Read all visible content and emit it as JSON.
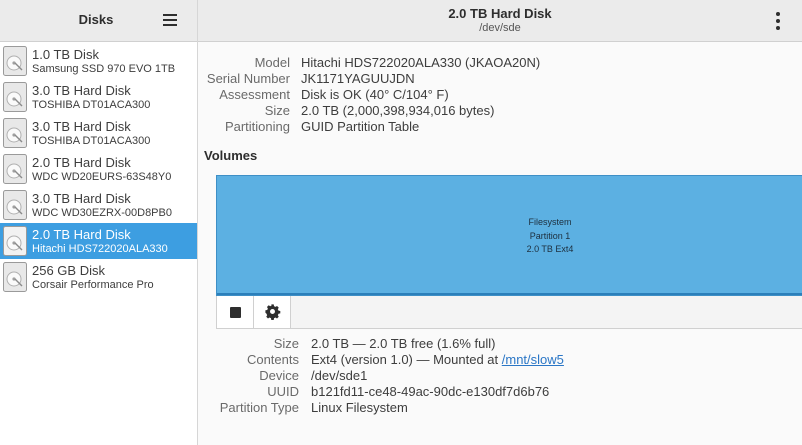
{
  "sidebar": {
    "title": "Disks",
    "disks": [
      {
        "name": "1.0 TB Disk",
        "model": "Samsung SSD 970 EVO 1TB"
      },
      {
        "name": "3.0 TB Hard Disk",
        "model": "TOSHIBA DT01ACA300"
      },
      {
        "name": "3.0 TB Hard Disk",
        "model": "TOSHIBA DT01ACA300"
      },
      {
        "name": "2.0 TB Hard Disk",
        "model": "WDC WD20EURS-63S48Y0"
      },
      {
        "name": "3.0 TB Hard Disk",
        "model": "WDC WD30EZRX-00D8PB0"
      },
      {
        "name": "2.0 TB Hard Disk",
        "model": "Hitachi HDS722020ALA330"
      },
      {
        "name": "256 GB Disk",
        "model": "Corsair Performance Pro"
      }
    ],
    "selected_index": 5
  },
  "header": {
    "title": "2.0 TB Hard Disk",
    "subtitle": "/dev/sde"
  },
  "disk_info": {
    "model_label": "Model",
    "model": "Hitachi HDS722020ALA330 (JKAOA20N)",
    "serial_label": "Serial Number",
    "serial": "JK1171YAGUUJDN",
    "assessment_label": "Assessment",
    "assessment": "Disk is OK (40° C/104° F)",
    "size_label": "Size",
    "size": "2.0 TB (2,000,398,934,016 bytes)",
    "partitioning_label": "Partitioning",
    "partitioning": "GUID Partition Table"
  },
  "volumes": {
    "label": "Volumes",
    "partition": {
      "line1": "Filesystem",
      "line2": "Partition 1",
      "line3": "2.0 TB Ext4"
    }
  },
  "partition_info": {
    "size_label": "Size",
    "size": "2.0 TB — 2.0 TB free (1.6% full)",
    "contents_label": "Contents",
    "contents_prefix": "Ext4 (version 1.0) — Mounted at ",
    "mount_point": "/mnt/slow5",
    "device_label": "Device",
    "device": "/dev/sde1",
    "uuid_label": "UUID",
    "uuid": "b121fd11-ce48-49ac-90dc-e130df7d6b76",
    "type_label": "Partition Type",
    "type": "Linux Filesystem"
  },
  "colors": {
    "selection": "#3d9ee1",
    "partition_fill": "#5cb0e2",
    "link": "#2a76c6"
  },
  "icons": {
    "menu": "hamburger-menu-icon",
    "more": "kebab-menu-icon",
    "disk": "hard-disk-icon",
    "stop": "stop-icon",
    "settings": "gear-icon"
  }
}
